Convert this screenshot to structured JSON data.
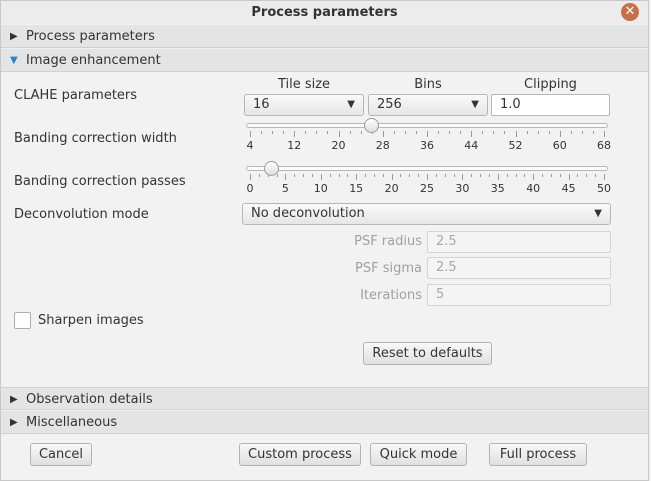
{
  "window": {
    "title": "Process parameters"
  },
  "sections": {
    "process": "Process parameters",
    "image": "Image enhancement",
    "observation": "Observation details",
    "misc": "Miscellaneous"
  },
  "clahe": {
    "label": "CLAHE parameters",
    "tile_header": "Tile size",
    "bins_header": "Bins",
    "clip_header": "Clipping",
    "tile_value": "16",
    "bins_value": "256",
    "clip_value": "1.0"
  },
  "banding_width": {
    "label": "Banding correction width",
    "value": 26,
    "min": 4,
    "max": 68,
    "ticks": [
      "4",
      "12",
      "20",
      "28",
      "36",
      "44",
      "52",
      "60",
      "68"
    ]
  },
  "banding_passes": {
    "label": "Banding correction passes",
    "value": 3,
    "min": 0,
    "max": 50,
    "ticks": [
      "0",
      "5",
      "10",
      "15",
      "20",
      "25",
      "30",
      "35",
      "40",
      "45",
      "50"
    ]
  },
  "deconv": {
    "label": "Deconvolution mode",
    "value": "No deconvolution",
    "psf_radius_label": "PSF radius",
    "psf_radius": "2.5",
    "psf_sigma_label": "PSF sigma",
    "psf_sigma": "2.5",
    "iterations_label": "Iterations",
    "iterations": "5"
  },
  "sharpen": {
    "label": "Sharpen images",
    "checked": false
  },
  "buttons": {
    "reset": "Reset to defaults",
    "cancel": "Cancel",
    "custom": "Custom process",
    "quick": "Quick mode",
    "full": "Full process"
  },
  "colors": {
    "accent": "#2a83c7",
    "close": "#c76e4a"
  }
}
